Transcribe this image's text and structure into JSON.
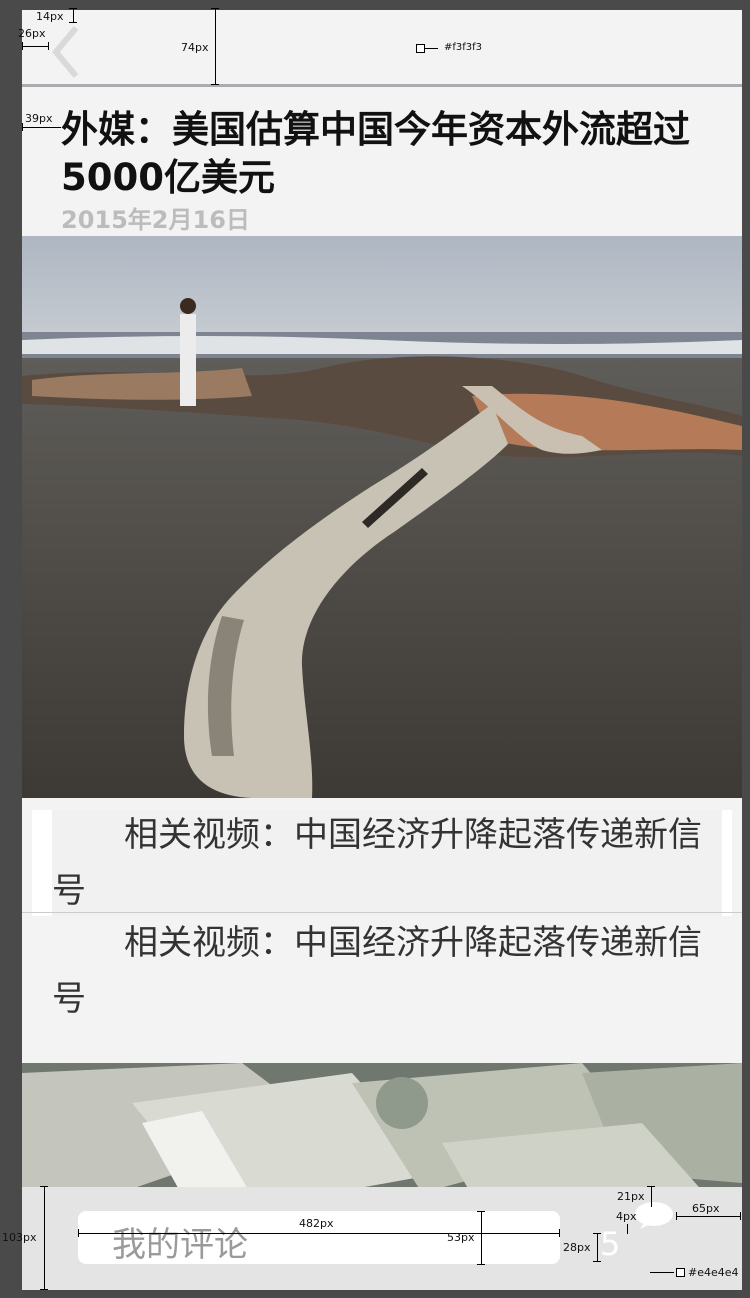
{
  "header": {
    "back_icon": "chevron-left-icon",
    "background": "#f3f3f3"
  },
  "article": {
    "title": "外媒：美国估算中国今年资本外流超过5000亿美元",
    "date": "2015年2月16日"
  },
  "related": {
    "label_1": "相关视频：中国经济升降起落传递新信号",
    "label_2": "相关视频：中国经济升降起落传递新信号"
  },
  "bottom_bar": {
    "background": "#e4e4e4",
    "comment_placeholder": "我的评论",
    "comment_count": "5",
    "bubble_icon": "comment-bubble-icon"
  },
  "annotations": {
    "a1": "14px",
    "a2": "26px",
    "a3": "74px",
    "a4": "#f3f3f3",
    "a5": "39px",
    "a6": "482px",
    "a7": "53px",
    "a8": "103px",
    "a9": "21px",
    "a10": "4px",
    "a11": "65px",
    "a12": "28px",
    "a13": "#e4e4e4"
  }
}
